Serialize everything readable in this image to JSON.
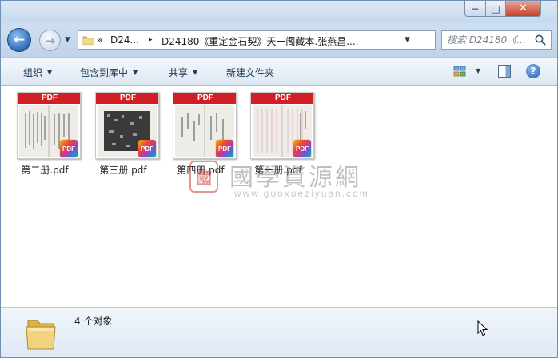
{
  "window": {
    "controls": {
      "minimize": "−",
      "maximize": "□",
      "close": "✕"
    }
  },
  "nav": {
    "back_icon": "arrow-left",
    "forward_icon": "arrow-right",
    "recent_icon": "chevron-down"
  },
  "address": {
    "chevron_left": "«",
    "segment_1": "D24...",
    "separator": "▸",
    "segment_2": "D24180《重定金石契》天一阁藏本.张燕昌....",
    "dropdown_icon": "chevron-down",
    "refresh_icon": "refresh"
  },
  "search": {
    "placeholder": "搜索 D24180《...",
    "icon": "search"
  },
  "commands": {
    "organize": "组织",
    "include_in_library": "包含到库中",
    "share": "共享",
    "new_folder": "新建文件夹",
    "view_icon": "view-grid",
    "preview_pane_icon": "preview-pane",
    "help_icon": "?"
  },
  "files": [
    {
      "name": "第二册.pdf",
      "band": "PDF",
      "badge": "PDF"
    },
    {
      "name": "第三册.pdf",
      "band": "PDF",
      "badge": "PDF"
    },
    {
      "name": "第四册.pdf",
      "band": "PDF",
      "badge": "PDF"
    },
    {
      "name": "第一册.pdf",
      "band": "PDF",
      "badge": "PDF"
    }
  ],
  "watermark": {
    "seal": "國",
    "title": "國學資源網",
    "url": "www.guoxueziyuan.com"
  },
  "status": {
    "count": "4 个对象"
  },
  "colors": {
    "pdf_red": "#d21f25",
    "titlebar": "#dbe7f5",
    "close_red": "#c7412b",
    "link_blue": "#1e3550"
  }
}
